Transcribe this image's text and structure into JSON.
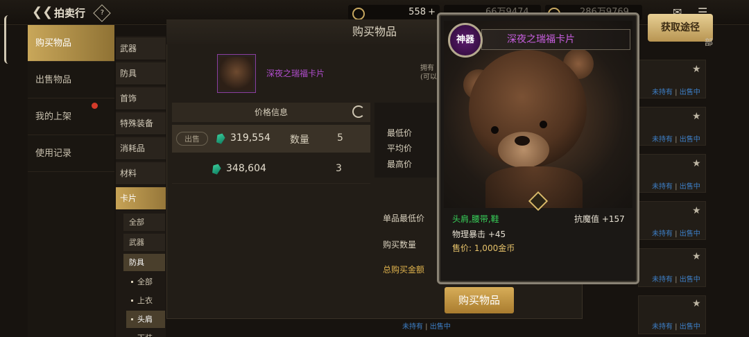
{
  "header": {
    "title": "拍卖行",
    "help": "?",
    "currency1": "558",
    "currency2": "66万9474",
    "currency3": "286万9769",
    "plus": "+"
  },
  "sidebar": {
    "items": [
      {
        "label": "购买物品"
      },
      {
        "label": "出售物品"
      },
      {
        "label": "我的上架"
      },
      {
        "label": "使用记录"
      }
    ]
  },
  "categories": {
    "items": [
      "武器",
      "防具",
      "首饰",
      "特殊装备",
      "消耗品",
      "材料",
      "卡片"
    ],
    "sub": [
      "全部",
      "武器",
      "防具"
    ],
    "subsub": [
      "全部",
      "上衣",
      "头肩",
      "下装"
    ]
  },
  "dialog": {
    "title": "购买物品",
    "item_name": "深夜之瑞福卡片",
    "owned_line1": "拥有",
    "owned_line2": "(可以",
    "price_header": "价格信息",
    "sell_label": "出售",
    "rows": [
      {
        "price": "319,554",
        "qty_label": "数量",
        "qty": "5"
      },
      {
        "price": "348,604",
        "qty_label": "",
        "qty": "3"
      }
    ],
    "min_price": "最低价",
    "avg_price": "平均价",
    "max_price": "最高价",
    "unit_min": "单品最低价",
    "buy_qty": "购买数量",
    "total": "总购买金额",
    "buy_button": "购买物品"
  },
  "card": {
    "rarity": "神器",
    "name": "深夜之瑞福卡片",
    "slots": "头肩,腰带,鞋",
    "stat1": "抗魔值 +157",
    "stat2": "物理暴击 +45",
    "sell_price": "售价: 1,000金币"
  },
  "right": {
    "get_button": "获取途径",
    "partial_tab": "部",
    "status_not_owned": "未持有",
    "status_sep": " | ",
    "status_selling": "出售中"
  }
}
